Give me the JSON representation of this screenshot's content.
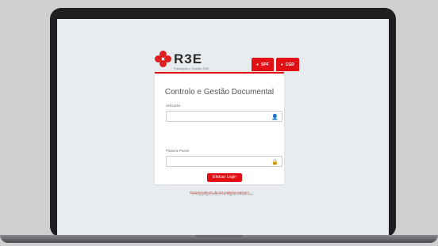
{
  "brand": {
    "logo_text": "R3E",
    "logo_subtitle": "Faturação e Gestão R3E",
    "accent_color": "#e20f14"
  },
  "header_tabs": [
    {
      "label": "SPF",
      "icon": "user-icon"
    },
    {
      "label": "CGD",
      "icon": "user-icon"
    }
  ],
  "login": {
    "title": "Controlo e Gestão Documental",
    "username_label": "Utilizador",
    "password_label": "Palavra-Passe",
    "username_value": "",
    "password_value": "",
    "submit_label": "Efetuar Login",
    "forgot_link": "Esqueceste-te da tua palavra-passe?"
  },
  "footer": {
    "copyright": "© Copyright 2022. All Rights Reserved."
  }
}
